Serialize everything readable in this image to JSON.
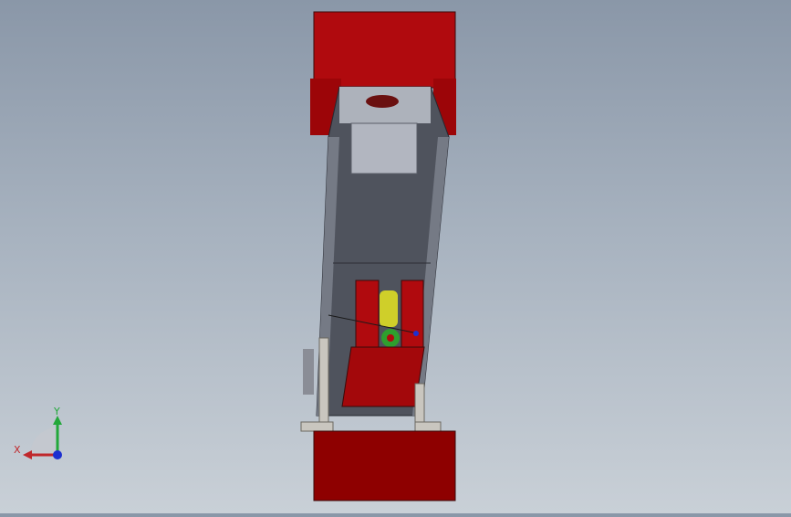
{
  "viewport": {
    "background_top": "#8a97a8",
    "background_bottom": "#c9d0d7",
    "part_color": "#b00a0e",
    "frame_color": "#4f535d",
    "highlight_color": "#cfcf2a",
    "pin_color": "#2ea02e"
  },
  "triad": {
    "x_label": "X",
    "y_label": "Y",
    "x_color": "#c0282c",
    "y_color": "#22a83a",
    "z_color": "#1c2fd0"
  }
}
